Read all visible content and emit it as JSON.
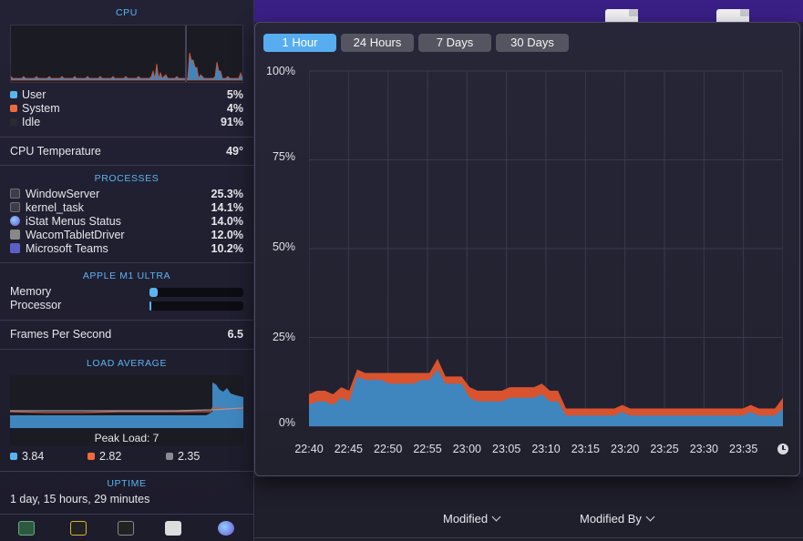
{
  "panel": {
    "cpu": {
      "title": "CPU",
      "rows": [
        {
          "label": "User",
          "value": "5%",
          "color": "#5ab4f2"
        },
        {
          "label": "System",
          "value": "4%",
          "color": "#ef6a3a"
        },
        {
          "label": "Idle",
          "value": "91%",
          "color": "#2a2a32"
        }
      ]
    },
    "temperature": {
      "label": "CPU Temperature",
      "value": "49°"
    },
    "processes": {
      "title": "PROCESSES",
      "items": [
        {
          "name": "WindowServer",
          "value": "25.3%",
          "icon": "terminal-icon"
        },
        {
          "name": "kernel_task",
          "value": "14.1%",
          "icon": "terminal-icon"
        },
        {
          "name": "iStat Menus Status",
          "value": "14.0%",
          "icon": "istat-icon"
        },
        {
          "name": "WacomTabletDriver",
          "value": "12.0%",
          "icon": "wacom-icon"
        },
        {
          "name": "Microsoft Teams",
          "value": "10.2%",
          "icon": "teams-icon"
        }
      ]
    },
    "gpu": {
      "title": "APPLE M1 ULTRA",
      "memory_label": "Memory",
      "processor_label": "Processor",
      "memory_level": 0.09,
      "processor_level": 0.02
    },
    "fps": {
      "label": "Frames Per Second",
      "value": "6.5"
    },
    "load": {
      "title": "LOAD AVERAGE",
      "peak": "Peak Load: 7",
      "values": [
        {
          "value": "3.84",
          "color": "#5ab4f2"
        },
        {
          "value": "2.82",
          "color": "#ef6a3a"
        },
        {
          "value": "2.35",
          "color": "#8a8a94"
        }
      ]
    },
    "uptime": {
      "title": "UPTIME",
      "value": "1 day, 15 hours, 29 minutes"
    }
  },
  "popup": {
    "tabs": [
      {
        "label": "1 Hour",
        "active": true
      },
      {
        "label": "24 Hours",
        "active": false
      },
      {
        "label": "7 Days",
        "active": false
      },
      {
        "label": "30 Days",
        "active": false
      }
    ]
  },
  "finder": {
    "modified": "Modified",
    "modified_by": "Modified By"
  },
  "chart_data": {
    "type": "area",
    "x_ticks": [
      "22:40",
      "22:45",
      "22:50",
      "22:55",
      "23:00",
      "23:05",
      "23:10",
      "23:15",
      "23:20",
      "23:25",
      "23:30",
      "23:35"
    ],
    "y_ticks": [
      "0%",
      "25%",
      "50%",
      "75%",
      "100%"
    ],
    "ylim": [
      0,
      100
    ],
    "grid": true,
    "series": [
      {
        "name": "User",
        "color": "#3f86bf",
        "values": [
          6,
          7,
          7,
          6,
          8,
          7,
          14,
          13,
          13,
          13,
          12,
          12,
          12,
          12,
          13,
          13,
          16,
          12,
          12,
          12,
          8,
          7,
          7,
          7,
          7,
          8,
          8,
          8,
          8,
          9,
          7,
          7,
          3,
          3,
          3,
          3,
          3,
          3,
          3,
          4,
          3,
          3,
          3,
          3,
          3,
          3,
          3,
          3,
          3,
          3,
          3,
          3,
          3,
          3,
          3,
          4,
          3,
          3,
          3,
          5
        ]
      },
      {
        "name": "System",
        "color": "#d8532e",
        "values": [
          3,
          3,
          3,
          3,
          3,
          3,
          2,
          2,
          2,
          2,
          3,
          3,
          3,
          3,
          2,
          2,
          3,
          2,
          2,
          2,
          3,
          3,
          3,
          3,
          3,
          3,
          3,
          3,
          3,
          3,
          3,
          3,
          2,
          2,
          2,
          2,
          2,
          2,
          2,
          2,
          2,
          2,
          2,
          2,
          2,
          2,
          2,
          2,
          2,
          2,
          2,
          2,
          2,
          2,
          2,
          2,
          2,
          2,
          2,
          3
        ]
      }
    ]
  }
}
